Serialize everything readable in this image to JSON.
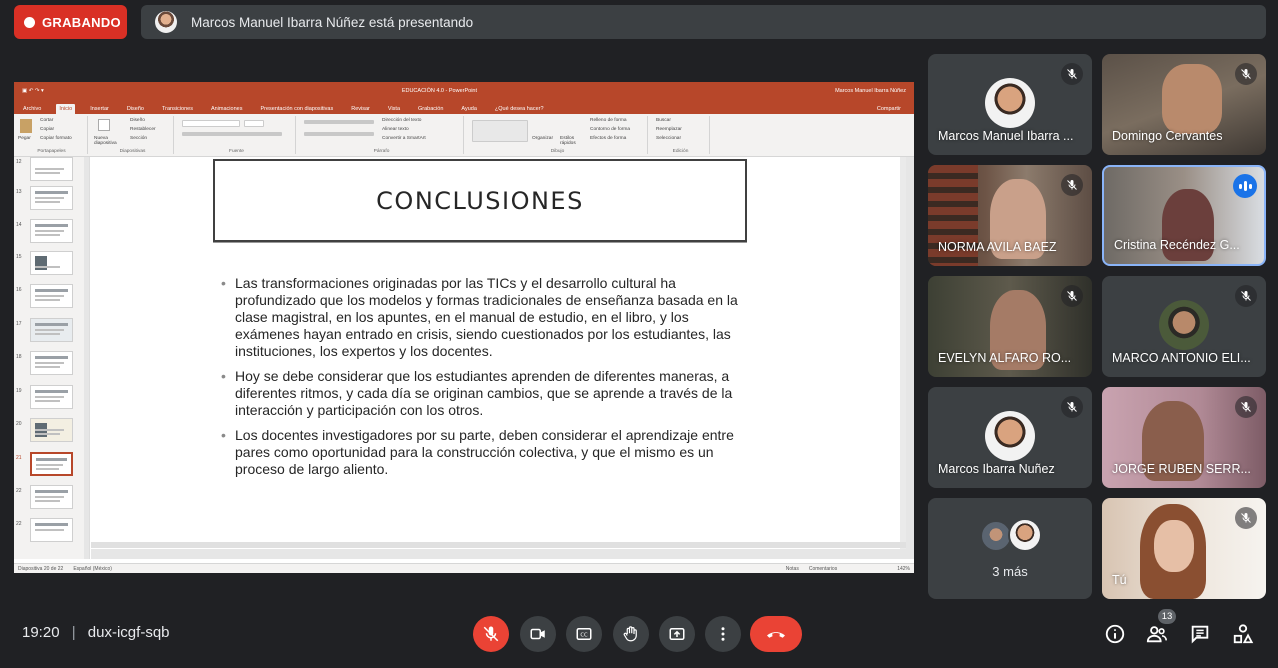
{
  "recording": {
    "label": "GRABANDO"
  },
  "presenting": {
    "text": "Marcos Manuel Ibarra Núñez está presentando"
  },
  "ppt": {
    "window_title": "EDUCACIÓN 4.0 - PowerPoint",
    "user": "Marcos Manuel Ibarra Núñez",
    "tabs": [
      "Archivo",
      "Inicio",
      "Insertar",
      "Diseño",
      "Transiciones",
      "Animaciones",
      "Presentación con diapositivas",
      "Revisar",
      "Vista",
      "Grabación",
      "Ayuda",
      "¿Qué desea hacer?"
    ],
    "share": "Compartir",
    "ribbon": {
      "clipboard_label": "Portapapeles",
      "paste": "Pegar",
      "cut": "Cortar",
      "copy": "Copiar",
      "format_painter": "Copiar formato",
      "slides_label": "Diapositivas",
      "new_slide": "Nueva diapositiva",
      "layout": "Diseño",
      "reset": "Restablecer",
      "section": "Sección",
      "font_label": "Fuente",
      "paragraph_label": "Párrafo",
      "text_direction": "Dirección del texto",
      "align_text": "Alinear texto",
      "smartart": "Convertir a SmartArt",
      "drawing_label": "Dibujo",
      "arrange": "Organizar",
      "quick_styles": "Estilos rápidos",
      "shape_fill": "Relleno de forma",
      "shape_outline": "Contorno de forma",
      "shape_effects": "Efectos de forma",
      "editing_label": "Edición",
      "find": "Buscar",
      "replace": "Reemplazar",
      "select": "Seleccionar"
    },
    "thumb_numbers": [
      "12",
      "13",
      "14",
      "15",
      "16",
      "17",
      "18",
      "19",
      "20",
      "21",
      "22"
    ],
    "selected_slide": 20,
    "slide": {
      "title": "CONCLUSIONES",
      "bullets": [
        "Las transformaciones originadas por las TICs y el desarrollo cultural ha profundizado que los modelos y formas tradicionales de enseñanza basada en la clase magistral, en los apuntes, en el manual de estudio, en el libro, y los exámenes hayan entrado en crisis, siendo cuestionados por los estudiantes, las instituciones, los expertos y los docentes.",
        "Hoy se debe considerar que los estudiantes aprenden de diferentes maneras, a diferentes ritmos, y cada día se originan cambios, que se aprende a través de la interacción y participación con los otros.",
        "Los docentes investigadores por su parte, deben considerar el aprendizaje entre pares como oportunidad para la construcción colectiva, y que el mismo es un proceso de largo aliento."
      ]
    },
    "status": {
      "slide_count": "Diapositiva 20 de 22",
      "language": "Español (México)",
      "notes": "Notas",
      "comments": "Comentarios",
      "zoom": "142%"
    }
  },
  "participants": [
    {
      "name": "Marcos Manuel Ibarra ..."
    },
    {
      "name": "Domingo Cervantes"
    },
    {
      "name": "NORMA AVILA BAEZ"
    },
    {
      "name": "Cristina Recéndez G..."
    },
    {
      "name": "EVELYN ALFARO RO..."
    },
    {
      "name": "MARCO ANTONIO ELI..."
    },
    {
      "name": "Marcos Ibarra Nuñez"
    },
    {
      "name": "JORGE RUBEN SERR..."
    },
    {
      "name": "3 más"
    },
    {
      "name": "Tú"
    }
  ],
  "bottom": {
    "time": "19:20",
    "separator": "|",
    "meeting_code": "dux-icgf-sqb",
    "people_count": "13"
  },
  "colors": {
    "record": "#d93025",
    "accent": "#8ab4f8",
    "end_call": "#ea4335",
    "ppt": "#b7472a"
  },
  "icons": [
    "mic-off-icon",
    "camera-icon",
    "captions-icon",
    "raise-hand-icon",
    "present-icon",
    "more-icon",
    "end-call-icon",
    "info-icon",
    "people-icon",
    "chat-icon",
    "activities-icon"
  ]
}
